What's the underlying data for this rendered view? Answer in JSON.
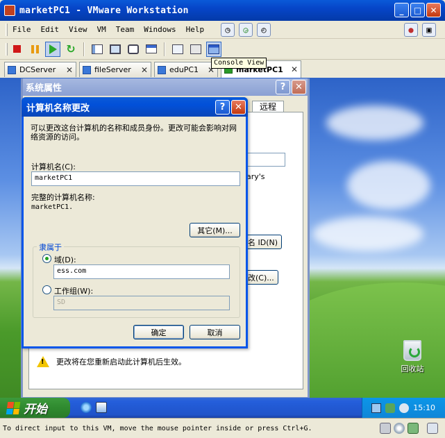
{
  "window": {
    "title": "marketPC1 - VMware Workstation",
    "controls": {
      "minimize": "_",
      "maximize": "□",
      "close": "✕"
    }
  },
  "menubar": {
    "items": [
      {
        "label": "File"
      },
      {
        "label": "Edit"
      },
      {
        "label": "View"
      },
      {
        "label": "VM"
      },
      {
        "label": "Team"
      },
      {
        "label": "Windows"
      },
      {
        "label": "Help"
      }
    ]
  },
  "tabs": [
    {
      "label": "DCServer"
    },
    {
      "label": "fileServer"
    },
    {
      "label": "eduPC1"
    },
    {
      "label": "marketPC1"
    }
  ],
  "tooltip": "Console View",
  "system_properties": {
    "title": "系统属性",
    "remote_tab": "远程",
    "partial_text": "ary's",
    "partial_btn_id": "名 ID(N)",
    "partial_btn_change": "改(C)...",
    "warning": "更改将在您重新启动此计算机后生效。"
  },
  "dialog": {
    "title": "计算机名称更改",
    "intro": "可以更改这台计算机的名称和成员身份。更改可能会影响对网络资源的访问。",
    "computer_name_label": "计算机名(C):",
    "computer_name_value": "marketPC1",
    "full_name_label": "完整的计算机名称:",
    "full_name_value": "marketPC1.",
    "more_button": "其它(M)...",
    "member_of_label": "隶属于",
    "domain_label": "域(D):",
    "domain_value": "ess.com",
    "workgroup_label": "工作组(W):",
    "workgroup_value": "SD",
    "ok_button": "确定",
    "cancel_button": "取消",
    "selected_membership": "domain"
  },
  "desktop": {
    "recycle_bin_label": "回收站"
  },
  "taskbar": {
    "start_label": "开始",
    "clock": "15:10"
  },
  "statusbar": {
    "text": "To direct input to this VM, move the mouse pointer inside or press Ctrl+G."
  },
  "colors": {
    "xp_blue": "#0055ea",
    "start_green": "#2f8a2f",
    "dialog_bg": "#ece9d8"
  }
}
